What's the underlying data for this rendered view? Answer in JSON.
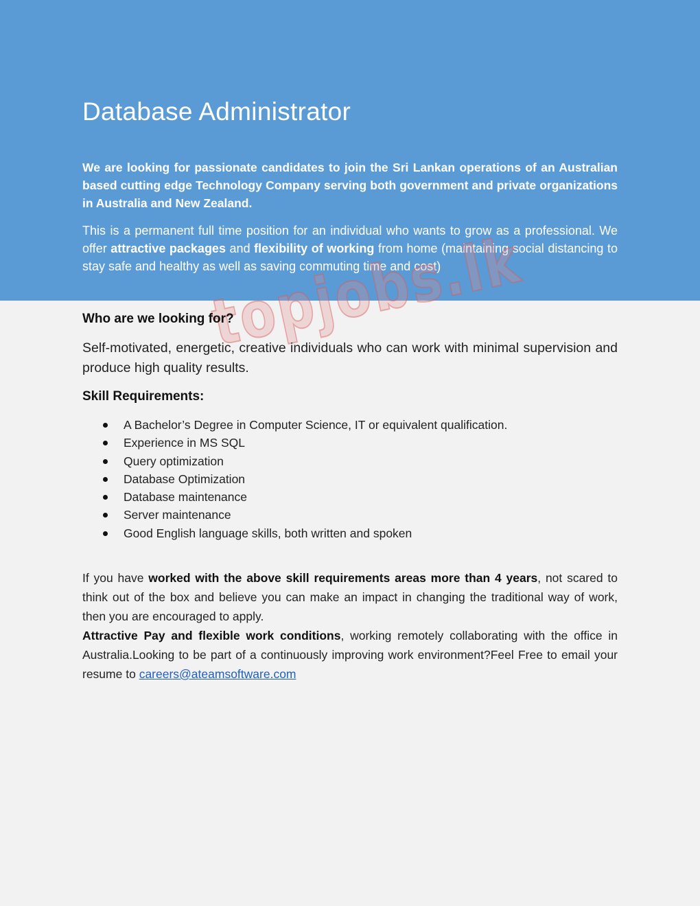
{
  "header": {
    "title": "Database Administrator",
    "intro": "We are looking for passionate candidates to join the Sri Lankan operations of an Australian based cutting edge Technology Company serving both government and private organizations in Australia and New Zealand.",
    "desc": {
      "part1": "This is a permanent full time position for an individual who wants to grow as a professional. We offer ",
      "bold1": "attractive packages",
      "part2": " and ",
      "bold2": "flexibility of working",
      "part3": " from home (maintaining social distancing to stay safe and healthy as well as saving commuting time and cost)"
    },
    "background_color": "#5b9bd5"
  },
  "watermark": {
    "text": "topjobs.lk"
  },
  "who": {
    "heading": "Who are we looking for?",
    "text": "Self-motivated, energetic, creative individuals who can work with minimal supervision and produce high quality results."
  },
  "skills": {
    "heading": "Skill Requirements:",
    "items": [
      "A Bachelor’s Degree in Computer Science, IT or equivalent qualification.",
      "Experience in MS SQL",
      "Query optimization",
      "Database Optimization",
      "Database maintenance",
      "Server maintenance",
      "Good English language skills, both written and spoken"
    ]
  },
  "apply": {
    "p1_part1": "If you have ",
    "p1_bold": "worked with the above skill requirements areas more than 4 years",
    "p1_part2": ", not scared to think out of the box and believe you can make an impact in changing the traditional way of work, then you are encouraged to apply.",
    "p2_bold": "Attractive Pay and flexible work conditions",
    "p2_part1": ", working remotely collaborating with the office in Australia.Looking to be part of a continuously improving work environment?Feel Free to email your resume to ",
    "email": "careers@ateamsoftware.com",
    "link_color": "#1f5fbf"
  }
}
